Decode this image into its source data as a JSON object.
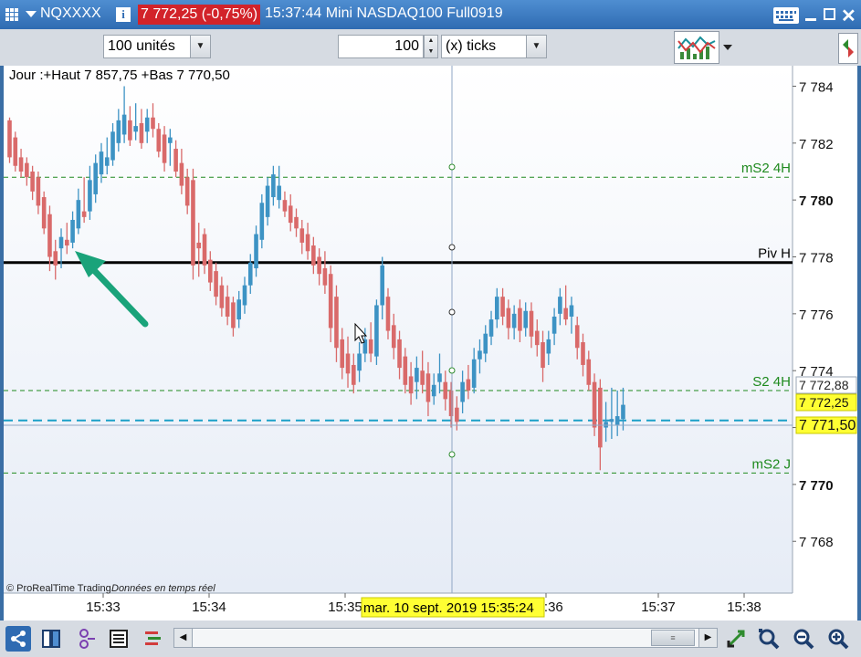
{
  "window": {
    "symbol": "NQXXXX",
    "price_badge": "7 772,25 (-0,75%)",
    "title": "15:37:44 Mini NASDAQ100 Full0919"
  },
  "toolbar": {
    "units_select": "100 unités",
    "ticks_value": "100",
    "ticks_unit_select": "(x) ticks"
  },
  "chart": {
    "info_label": "Jour :+Haut 7 857,75 +Bas 7 770,50",
    "copyright": "© ProRealTime Trading",
    "realtime_note": "Données en temps réel",
    "cursor_datetime": "mar. 10 sept. 2019 15:35:24",
    "level_labels": {
      "ms2_4h": "mS2 4H",
      "piv_h": "Piv H",
      "s2_4h": "S2 4H",
      "ms2_j": "mS2 J"
    },
    "price_ticks": [
      "7 784",
      "7 782",
      "7 780",
      "7 778",
      "7 776",
      "7 774",
      "7 772",
      "7 770",
      "7 768"
    ],
    "price_tags": {
      "high_tag": "7 772,88",
      "last_tag": "7 772,25",
      "cursor_tag": "7 771,50"
    },
    "time_ticks": [
      "15:33",
      "15:34",
      "15:35",
      "15:36",
      "15:37",
      "15:38"
    ],
    "colors": {
      "up": "#3d93c4",
      "down": "#d96a6a",
      "pivot": "#000000",
      "support": "#1e8a1e",
      "last_price": "#1aa0c8",
      "arrow": "#1aa37a"
    }
  },
  "chart_data": {
    "type": "candlestick",
    "ylim": [
      7766.5,
      7784.4
    ],
    "x_ticks": [
      "15:33",
      "15:34",
      "15:35",
      "15:36",
      "15:37",
      "15:38"
    ],
    "levels": [
      {
        "name": "mS2 4H",
        "value": 7780.8
      },
      {
        "name": "Piv H",
        "value": 7777.8
      },
      {
        "name": "S2 4H",
        "value": 7773.3
      },
      {
        "name": "mS2 J",
        "value": 7770.4
      }
    ],
    "last_price": 7772.25,
    "candles": [
      {
        "o": 7782.8,
        "h": 7782.9,
        "l": 7781.3,
        "c": 7781.5
      },
      {
        "o": 7782.2,
        "h": 7782.4,
        "l": 7781.0,
        "c": 7781.2
      },
      {
        "o": 7781.5,
        "h": 7781.8,
        "l": 7780.8,
        "c": 7781.0
      },
      {
        "o": 7781.3,
        "h": 7781.5,
        "l": 7780.5,
        "c": 7780.8
      },
      {
        "o": 7781.0,
        "h": 7781.2,
        "l": 7780.0,
        "c": 7780.3
      },
      {
        "o": 7780.8,
        "h": 7781.0,
        "l": 7779.5,
        "c": 7779.8
      },
      {
        "o": 7780.1,
        "h": 7780.3,
        "l": 7778.8,
        "c": 7779.0
      },
      {
        "o": 7779.5,
        "h": 7779.8,
        "l": 7777.5,
        "c": 7778.0
      },
      {
        "o": 7778.2,
        "h": 7778.6,
        "l": 7777.2,
        "c": 7777.7
      },
      {
        "o": 7778.3,
        "h": 7779.0,
        "l": 7777.6,
        "c": 7778.7
      },
      {
        "o": 7778.6,
        "h": 7779.2,
        "l": 7778.1,
        "c": 7778.4
      },
      {
        "o": 7778.5,
        "h": 7779.6,
        "l": 7778.3,
        "c": 7779.3
      },
      {
        "o": 7779.0,
        "h": 7780.4,
        "l": 7778.8,
        "c": 7780.0
      },
      {
        "o": 7779.6,
        "h": 7780.8,
        "l": 7779.2,
        "c": 7779.4
      },
      {
        "o": 7779.6,
        "h": 7781.2,
        "l": 7779.3,
        "c": 7780.7
      },
      {
        "o": 7780.2,
        "h": 7781.6,
        "l": 7779.9,
        "c": 7781.3
      },
      {
        "o": 7780.9,
        "h": 7782.0,
        "l": 7780.6,
        "c": 7781.7
      },
      {
        "o": 7781.2,
        "h": 7782.2,
        "l": 7780.9,
        "c": 7781.5
      },
      {
        "o": 7781.4,
        "h": 7782.7,
        "l": 7781.2,
        "c": 7782.4
      },
      {
        "o": 7782.0,
        "h": 7783.2,
        "l": 7781.7,
        "c": 7782.8
      },
      {
        "o": 7782.3,
        "h": 7784.0,
        "l": 7782.0,
        "c": 7783.0
      },
      {
        "o": 7782.8,
        "h": 7783.3,
        "l": 7781.9,
        "c": 7782.1
      },
      {
        "o": 7782.4,
        "h": 7783.4,
        "l": 7782.1,
        "c": 7782.6
      },
      {
        "o": 7782.7,
        "h": 7783.2,
        "l": 7781.8,
        "c": 7782.0
      },
      {
        "o": 7782.4,
        "h": 7783.2,
        "l": 7782.0,
        "c": 7782.9
      },
      {
        "o": 7782.9,
        "h": 7783.4,
        "l": 7782.2,
        "c": 7782.5
      },
      {
        "o": 7782.5,
        "h": 7782.7,
        "l": 7781.5,
        "c": 7781.7
      },
      {
        "o": 7782.3,
        "h": 7782.6,
        "l": 7781.0,
        "c": 7781.3
      },
      {
        "o": 7782.0,
        "h": 7782.5,
        "l": 7781.2,
        "c": 7782.2
      },
      {
        "o": 7781.8,
        "h": 7782.1,
        "l": 7780.8,
        "c": 7781.0
      },
      {
        "o": 7781.3,
        "h": 7781.8,
        "l": 7780.2,
        "c": 7780.5
      },
      {
        "o": 7780.8,
        "h": 7781.1,
        "l": 7779.5,
        "c": 7779.8
      },
      {
        "o": 7780.7,
        "h": 7781.1,
        "l": 7777.2,
        "c": 7777.7
      },
      {
        "o": 7778.5,
        "h": 7779.2,
        "l": 7777.3,
        "c": 7778.3
      },
      {
        "o": 7778.8,
        "h": 7779.0,
        "l": 7777.4,
        "c": 7777.7
      },
      {
        "o": 7777.9,
        "h": 7778.2,
        "l": 7776.8,
        "c": 7777.1
      },
      {
        "o": 7777.5,
        "h": 7777.8,
        "l": 7776.3,
        "c": 7776.6
      },
      {
        "o": 7777.0,
        "h": 7777.3,
        "l": 7775.9,
        "c": 7776.2
      },
      {
        "o": 7776.6,
        "h": 7777.0,
        "l": 7775.6,
        "c": 7775.9
      },
      {
        "o": 7776.4,
        "h": 7776.6,
        "l": 7775.2,
        "c": 7775.5
      },
      {
        "o": 7775.8,
        "h": 7776.8,
        "l": 7775.5,
        "c": 7776.5
      },
      {
        "o": 7776.3,
        "h": 7777.3,
        "l": 7776.0,
        "c": 7777.0
      },
      {
        "o": 7777.0,
        "h": 7778.1,
        "l": 7776.7,
        "c": 7777.8
      },
      {
        "o": 7777.6,
        "h": 7779.1,
        "l": 7777.3,
        "c": 7778.8
      },
      {
        "o": 7778.6,
        "h": 7780.2,
        "l": 7778.3,
        "c": 7779.9
      },
      {
        "o": 7779.4,
        "h": 7780.8,
        "l": 7779.1,
        "c": 7780.5
      },
      {
        "o": 7780.1,
        "h": 7781.2,
        "l": 7779.8,
        "c": 7780.9
      },
      {
        "o": 7780.0,
        "h": 7781.2,
        "l": 7779.7,
        "c": 7780.5
      },
      {
        "o": 7780.0,
        "h": 7780.3,
        "l": 7779.4,
        "c": 7779.6
      },
      {
        "o": 7779.8,
        "h": 7780.2,
        "l": 7778.9,
        "c": 7779.2
      },
      {
        "o": 7779.4,
        "h": 7779.7,
        "l": 7778.7,
        "c": 7779.0
      },
      {
        "o": 7779.0,
        "h": 7779.3,
        "l": 7778.1,
        "c": 7778.5
      },
      {
        "o": 7778.8,
        "h": 7779.2,
        "l": 7777.9,
        "c": 7778.2
      },
      {
        "o": 7778.4,
        "h": 7778.7,
        "l": 7777.4,
        "c": 7777.7
      },
      {
        "o": 7778.0,
        "h": 7778.3,
        "l": 7777.0,
        "c": 7777.4
      },
      {
        "o": 7777.6,
        "h": 7778.2,
        "l": 7776.7,
        "c": 7777.0
      },
      {
        "o": 7777.4,
        "h": 7777.7,
        "l": 7775.0,
        "c": 7775.5
      },
      {
        "o": 7776.6,
        "h": 7777.0,
        "l": 7774.3,
        "c": 7774.8
      },
      {
        "o": 7775.1,
        "h": 7775.5,
        "l": 7773.7,
        "c": 7774.1
      },
      {
        "o": 7774.6,
        "h": 7775.2,
        "l": 7773.4,
        "c": 7773.9
      },
      {
        "o": 7774.2,
        "h": 7774.6,
        "l": 7773.2,
        "c": 7773.5
      },
      {
        "o": 7774.0,
        "h": 7775.0,
        "l": 7773.6,
        "c": 7774.6
      },
      {
        "o": 7774.6,
        "h": 7775.5,
        "l": 7774.3,
        "c": 7775.1
      },
      {
        "o": 7775.1,
        "h": 7775.7,
        "l": 7774.3,
        "c": 7774.6
      },
      {
        "o": 7774.5,
        "h": 7776.5,
        "l": 7774.2,
        "c": 7776.3
      },
      {
        "o": 7776.3,
        "h": 7778.0,
        "l": 7775.8,
        "c": 7777.7
      },
      {
        "o": 7776.6,
        "h": 7776.9,
        "l": 7775.1,
        "c": 7775.4
      },
      {
        "o": 7775.6,
        "h": 7776.0,
        "l": 7774.4,
        "c": 7774.8
      },
      {
        "o": 7775.1,
        "h": 7775.4,
        "l": 7773.7,
        "c": 7774.1
      },
      {
        "o": 7774.5,
        "h": 7774.8,
        "l": 7773.2,
        "c": 7773.5
      },
      {
        "o": 7773.8,
        "h": 7774.3,
        "l": 7772.8,
        "c": 7773.2
      },
      {
        "o": 7773.6,
        "h": 7774.5,
        "l": 7773.0,
        "c": 7774.1
      },
      {
        "o": 7774.0,
        "h": 7774.7,
        "l": 7773.2,
        "c": 7773.5
      },
      {
        "o": 7773.9,
        "h": 7774.3,
        "l": 7772.4,
        "c": 7772.9
      },
      {
        "o": 7773.1,
        "h": 7773.9,
        "l": 7772.8,
        "c": 7773.5
      },
      {
        "o": 7773.6,
        "h": 7774.6,
        "l": 7773.2,
        "c": 7773.9
      },
      {
        "o": 7773.6,
        "h": 7774.0,
        "l": 7772.6,
        "c": 7773.0
      },
      {
        "o": 7773.3,
        "h": 7773.6,
        "l": 7772.0,
        "c": 7772.4
      },
      {
        "o": 7772.7,
        "h": 7773.1,
        "l": 7771.9,
        "c": 7772.2
      },
      {
        "o": 7772.9,
        "h": 7774.0,
        "l": 7772.5,
        "c": 7773.6
      },
      {
        "o": 7773.7,
        "h": 7774.2,
        "l": 7773.0,
        "c": 7773.3
      },
      {
        "o": 7773.4,
        "h": 7774.8,
        "l": 7773.2,
        "c": 7774.4
      },
      {
        "o": 7774.4,
        "h": 7775.1,
        "l": 7773.9,
        "c": 7774.7
      },
      {
        "o": 7774.6,
        "h": 7775.6,
        "l": 7774.3,
        "c": 7775.3
      },
      {
        "o": 7775.2,
        "h": 7776.1,
        "l": 7774.9,
        "c": 7775.8
      },
      {
        "o": 7775.8,
        "h": 7776.9,
        "l": 7775.5,
        "c": 7776.6
      },
      {
        "o": 7776.6,
        "h": 7776.9,
        "l": 7775.6,
        "c": 7775.9
      },
      {
        "o": 7776.2,
        "h": 7776.5,
        "l": 7775.1,
        "c": 7775.5
      },
      {
        "o": 7775.5,
        "h": 7776.3,
        "l": 7775.1,
        "c": 7776.0
      },
      {
        "o": 7776.2,
        "h": 7776.5,
        "l": 7775.0,
        "c": 7775.4
      },
      {
        "o": 7775.5,
        "h": 7776.4,
        "l": 7775.2,
        "c": 7776.1
      },
      {
        "o": 7776.1,
        "h": 7776.4,
        "l": 7774.8,
        "c": 7775.2
      },
      {
        "o": 7775.4,
        "h": 7775.8,
        "l": 7774.5,
        "c": 7774.9
      },
      {
        "o": 7775.0,
        "h": 7775.4,
        "l": 7773.6,
        "c": 7774.1
      },
      {
        "o": 7774.6,
        "h": 7775.4,
        "l": 7774.2,
        "c": 7775.1
      },
      {
        "o": 7775.3,
        "h": 7776.2,
        "l": 7774.9,
        "c": 7775.9
      },
      {
        "o": 7776.0,
        "h": 7776.9,
        "l": 7775.6,
        "c": 7776.6
      },
      {
        "o": 7776.2,
        "h": 7777.0,
        "l": 7775.6,
        "c": 7775.8
      },
      {
        "o": 7775.9,
        "h": 7776.6,
        "l": 7775.3,
        "c": 7776.3
      },
      {
        "o": 7775.6,
        "h": 7775.9,
        "l": 7774.4,
        "c": 7774.8
      },
      {
        "o": 7775.0,
        "h": 7775.3,
        "l": 7773.8,
        "c": 7774.2
      },
      {
        "o": 7774.4,
        "h": 7774.7,
        "l": 7773.3,
        "c": 7773.5
      },
      {
        "o": 7773.6,
        "h": 7773.9,
        "l": 7771.7,
        "c": 7772.0
      },
      {
        "o": 7773.4,
        "h": 7773.7,
        "l": 7770.5,
        "c": 7771.3
      },
      {
        "o": 7772.0,
        "h": 7772.9,
        "l": 7771.5,
        "c": 7772.2
      },
      {
        "o": 7772.2,
        "h": 7773.4,
        "l": 7771.6,
        "c": 7772.3
      },
      {
        "o": 7772.1,
        "h": 7773.3,
        "l": 7771.7,
        "c": 7772.4
      },
      {
        "o": 7772.3,
        "h": 7773.4,
        "l": 7771.9,
        "c": 7772.8
      }
    ]
  }
}
